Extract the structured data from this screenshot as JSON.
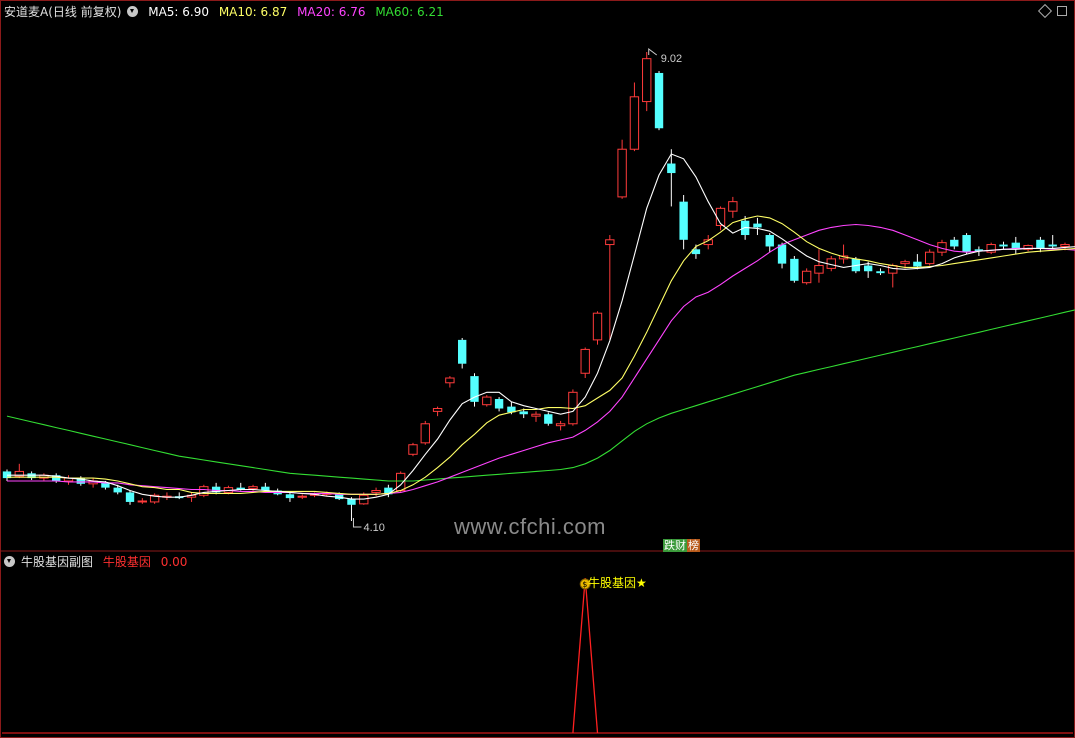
{
  "main_panel": {
    "stock_title": "安道麦A(日线 前复权)",
    "ma_legend": [
      {
        "label": "MA5: 6.90",
        "color": "#ffffff"
      },
      {
        "label": "MA10: 6.87",
        "color": "#ffff66"
      },
      {
        "label": "MA20: 6.76",
        "color": "#ff44ff"
      },
      {
        "label": "MA60: 6.21",
        "color": "#33dd33"
      }
    ],
    "high_label": "9.02",
    "low_label": "4.10",
    "badge_left": "跌财",
    "badge_right": "榜"
  },
  "sub_panel": {
    "title": "牛股基因副图",
    "indicator_name": "牛股基因",
    "indicator_value": "0.00",
    "signal_label": "牛股基因★"
  },
  "watermark": "www.cfchi.com",
  "colors": {
    "up": "#ff3b3b",
    "down": "#54ffff",
    "ma5": "#ffffff",
    "ma10": "#ffff66",
    "ma20": "#ff44ff",
    "ma60": "#33dd33",
    "signal": "#ff2020"
  },
  "chart_data": {
    "type": "candlestick",
    "price_range": [
      4.1,
      9.02
    ],
    "candles": [
      {
        "o": 4.62,
        "h": 4.64,
        "l": 4.52,
        "c": 4.55
      },
      {
        "o": 4.57,
        "h": 4.7,
        "l": 4.55,
        "c": 4.62
      },
      {
        "o": 4.6,
        "h": 4.62,
        "l": 4.53,
        "c": 4.55
      },
      {
        "o": 4.55,
        "h": 4.6,
        "l": 4.52,
        "c": 4.58
      },
      {
        "o": 4.58,
        "h": 4.6,
        "l": 4.5,
        "c": 4.52
      },
      {
        "o": 4.52,
        "h": 4.58,
        "l": 4.48,
        "c": 4.55
      },
      {
        "o": 4.55,
        "h": 4.57,
        "l": 4.47,
        "c": 4.49
      },
      {
        "o": 4.49,
        "h": 4.55,
        "l": 4.45,
        "c": 4.52
      },
      {
        "o": 4.5,
        "h": 4.52,
        "l": 4.43,
        "c": 4.45
      },
      {
        "o": 4.45,
        "h": 4.48,
        "l": 4.38,
        "c": 4.4
      },
      {
        "o": 4.4,
        "h": 4.42,
        "l": 4.27,
        "c": 4.3
      },
      {
        "o": 4.3,
        "h": 4.34,
        "l": 4.28,
        "c": 4.31
      },
      {
        "o": 4.3,
        "h": 4.39,
        "l": 4.28,
        "c": 4.37
      },
      {
        "o": 4.35,
        "h": 4.4,
        "l": 4.32,
        "c": 4.36
      },
      {
        "o": 4.36,
        "h": 4.4,
        "l": 4.33,
        "c": 4.34
      },
      {
        "o": 4.35,
        "h": 4.4,
        "l": 4.3,
        "c": 4.37
      },
      {
        "o": 4.37,
        "h": 4.48,
        "l": 4.35,
        "c": 4.46
      },
      {
        "o": 4.46,
        "h": 4.5,
        "l": 4.38,
        "c": 4.4
      },
      {
        "o": 4.4,
        "h": 4.47,
        "l": 4.38,
        "c": 4.45
      },
      {
        "o": 4.45,
        "h": 4.5,
        "l": 4.42,
        "c": 4.43
      },
      {
        "o": 4.44,
        "h": 4.48,
        "l": 4.4,
        "c": 4.46
      },
      {
        "o": 4.46,
        "h": 4.5,
        "l": 4.41,
        "c": 4.42
      },
      {
        "o": 4.42,
        "h": 4.44,
        "l": 4.37,
        "c": 4.38
      },
      {
        "o": 4.38,
        "h": 4.4,
        "l": 4.3,
        "c": 4.34
      },
      {
        "o": 4.35,
        "h": 4.38,
        "l": 4.33,
        "c": 4.36
      },
      {
        "o": 4.37,
        "h": 4.4,
        "l": 4.35,
        "c": 4.38
      },
      {
        "o": 4.38,
        "h": 4.41,
        "l": 4.36,
        "c": 4.39
      },
      {
        "o": 4.39,
        "h": 4.4,
        "l": 4.32,
        "c": 4.33
      },
      {
        "o": 4.33,
        "h": 4.35,
        "l": 4.1,
        "c": 4.27
      },
      {
        "o": 4.28,
        "h": 4.4,
        "l": 4.27,
        "c": 4.37
      },
      {
        "o": 4.4,
        "h": 4.45,
        "l": 4.36,
        "c": 4.42
      },
      {
        "o": 4.45,
        "h": 4.48,
        "l": 4.35,
        "c": 4.38
      },
      {
        "o": 4.42,
        "h": 4.62,
        "l": 4.4,
        "c": 4.6
      },
      {
        "o": 4.8,
        "h": 4.92,
        "l": 4.78,
        "c": 4.9
      },
      {
        "o": 4.92,
        "h": 5.15,
        "l": 4.9,
        "c": 5.12
      },
      {
        "o": 5.25,
        "h": 5.3,
        "l": 5.2,
        "c": 5.28
      },
      {
        "o": 5.55,
        "h": 5.62,
        "l": 5.5,
        "c": 5.6
      },
      {
        "o": 6.0,
        "h": 6.02,
        "l": 5.7,
        "c": 5.75
      },
      {
        "o": 5.62,
        "h": 5.65,
        "l": 5.3,
        "c": 5.35
      },
      {
        "o": 5.32,
        "h": 5.42,
        "l": 5.3,
        "c": 5.4
      },
      {
        "o": 5.38,
        "h": 5.4,
        "l": 5.25,
        "c": 5.28
      },
      {
        "o": 5.3,
        "h": 5.35,
        "l": 5.22,
        "c": 5.24
      },
      {
        "o": 5.25,
        "h": 5.28,
        "l": 5.18,
        "c": 5.22
      },
      {
        "o": 5.2,
        "h": 5.25,
        "l": 5.14,
        "c": 5.22
      },
      {
        "o": 5.22,
        "h": 5.24,
        "l": 5.1,
        "c": 5.12
      },
      {
        "o": 5.1,
        "h": 5.15,
        "l": 5.05,
        "c": 5.12
      },
      {
        "o": 5.12,
        "h": 5.48,
        "l": 5.1,
        "c": 5.45
      },
      {
        "o": 5.65,
        "h": 5.92,
        "l": 5.6,
        "c": 5.9
      },
      {
        "o": 6.0,
        "h": 6.3,
        "l": 5.95,
        "c": 6.28
      },
      {
        "o": 7.0,
        "h": 7.1,
        "l": 6.0,
        "c": 7.05
      },
      {
        "o": 7.5,
        "h": 8.1,
        "l": 7.48,
        "c": 8.0
      },
      {
        "o": 8.0,
        "h": 8.7,
        "l": 7.98,
        "c": 8.55
      },
      {
        "o": 8.5,
        "h": 9.02,
        "l": 8.4,
        "c": 8.95
      },
      {
        "o": 8.8,
        "h": 8.82,
        "l": 8.2,
        "c": 8.22
      },
      {
        "o": 7.85,
        "h": 8.0,
        "l": 7.4,
        "c": 7.75
      },
      {
        "o": 7.45,
        "h": 7.52,
        "l": 6.95,
        "c": 7.05
      },
      {
        "o": 6.95,
        "h": 7.0,
        "l": 6.85,
        "c": 6.9
      },
      {
        "o": 7.0,
        "h": 7.1,
        "l": 6.95,
        "c": 7.05
      },
      {
        "o": 7.2,
        "h": 7.4,
        "l": 7.15,
        "c": 7.38
      },
      {
        "o": 7.35,
        "h": 7.5,
        "l": 7.28,
        "c": 7.45
      },
      {
        "o": 7.25,
        "h": 7.3,
        "l": 7.05,
        "c": 7.1
      },
      {
        "o": 7.22,
        "h": 7.28,
        "l": 7.1,
        "c": 7.18
      },
      {
        "o": 7.1,
        "h": 7.12,
        "l": 6.92,
        "c": 6.98
      },
      {
        "o": 7.0,
        "h": 7.02,
        "l": 6.75,
        "c": 6.8
      },
      {
        "o": 6.85,
        "h": 6.88,
        "l": 6.6,
        "c": 6.62
      },
      {
        "o": 6.6,
        "h": 6.75,
        "l": 6.58,
        "c": 6.72
      },
      {
        "o": 6.7,
        "h": 6.95,
        "l": 6.6,
        "c": 6.78
      },
      {
        "o": 6.75,
        "h": 6.88,
        "l": 6.72,
        "c": 6.85
      },
      {
        "o": 6.85,
        "h": 7.0,
        "l": 6.8,
        "c": 6.88
      },
      {
        "o": 6.85,
        "h": 6.87,
        "l": 6.7,
        "c": 6.72
      },
      {
        "o": 6.78,
        "h": 6.82,
        "l": 6.65,
        "c": 6.72
      },
      {
        "o": 6.72,
        "h": 6.75,
        "l": 6.68,
        "c": 6.7
      },
      {
        "o": 6.7,
        "h": 6.8,
        "l": 6.55,
        "c": 6.78
      },
      {
        "o": 6.8,
        "h": 6.84,
        "l": 6.75,
        "c": 6.82
      },
      {
        "o": 6.82,
        "h": 6.9,
        "l": 6.74,
        "c": 6.77
      },
      {
        "o": 6.8,
        "h": 6.95,
        "l": 6.78,
        "c": 6.92
      },
      {
        "o": 6.92,
        "h": 7.05,
        "l": 6.88,
        "c": 7.02
      },
      {
        "o": 7.05,
        "h": 7.08,
        "l": 6.95,
        "c": 6.98
      },
      {
        "o": 7.1,
        "h": 7.12,
        "l": 6.9,
        "c": 6.92
      },
      {
        "o": 6.95,
        "h": 6.98,
        "l": 6.88,
        "c": 6.93
      },
      {
        "o": 6.92,
        "h": 7.02,
        "l": 6.9,
        "c": 7.0
      },
      {
        "o": 7.0,
        "h": 7.03,
        "l": 6.95,
        "c": 6.98
      },
      {
        "o": 7.02,
        "h": 7.08,
        "l": 6.9,
        "c": 6.95
      },
      {
        "o": 6.95,
        "h": 7.0,
        "l": 6.93,
        "c": 6.99
      },
      {
        "o": 7.05,
        "h": 7.08,
        "l": 6.92,
        "c": 6.96
      },
      {
        "o": 7.0,
        "h": 7.1,
        "l": 6.95,
        "c": 6.98
      },
      {
        "o": 6.98,
        "h": 7.02,
        "l": 6.94,
        "c": 7.0
      }
    ],
    "ma5": [
      4.58,
      4.58,
      4.58,
      4.58,
      4.57,
      4.55,
      4.54,
      4.52,
      4.51,
      4.47,
      4.42,
      4.38,
      4.36,
      4.35,
      4.35,
      4.37,
      4.4,
      4.41,
      4.42,
      4.43,
      4.43,
      4.42,
      4.41,
      4.4,
      4.39,
      4.38,
      4.36,
      4.35,
      4.33,
      4.33,
      4.35,
      4.38,
      4.48,
      4.63,
      4.8,
      4.96,
      5.16,
      5.33,
      5.4,
      5.45,
      5.45,
      5.35,
      5.31,
      5.28,
      5.25,
      5.22,
      5.25,
      5.4,
      5.65,
      5.99,
      6.41,
      6.89,
      7.38,
      7.73,
      7.95,
      7.9,
      7.71,
      7.45,
      7.22,
      7.12,
      7.18,
      7.17,
      7.14,
      7.06,
      6.97,
      6.88,
      6.82,
      6.79,
      6.76,
      6.78,
      6.8,
      6.78,
      6.75,
      6.74,
      6.75,
      6.76,
      6.8,
      6.86,
      6.9,
      6.93,
      6.94,
      6.95,
      6.95,
      6.96,
      6.96,
      6.96,
      6.97,
      6.98
    ],
    "ma10": [
      4.56,
      4.56,
      4.56,
      4.56,
      4.56,
      4.55,
      4.55,
      4.55,
      4.54,
      4.52,
      4.49,
      4.46,
      4.45,
      4.43,
      4.43,
      4.4,
      4.39,
      4.39,
      4.39,
      4.39,
      4.4,
      4.41,
      4.41,
      4.41,
      4.41,
      4.41,
      4.4,
      4.39,
      4.38,
      4.38,
      4.38,
      4.39,
      4.42,
      4.48,
      4.56,
      4.66,
      4.77,
      4.9,
      5.01,
      5.13,
      5.21,
      5.24,
      5.27,
      5.27,
      5.29,
      5.29,
      5.28,
      5.31,
      5.39,
      5.47,
      5.6,
      5.83,
      6.08,
      6.35,
      6.62,
      6.83,
      6.98,
      7.04,
      7.13,
      7.23,
      7.27,
      7.3,
      7.28,
      7.22,
      7.13,
      7.03,
      6.96,
      6.91,
      6.87,
      6.85,
      6.83,
      6.8,
      6.78,
      6.76,
      6.76,
      6.77,
      6.78,
      6.8,
      6.82,
      6.84,
      6.86,
      6.88,
      6.9,
      6.92,
      6.93,
      6.94,
      6.95,
      6.96
    ],
    "ma20": [
      4.52,
      4.52,
      4.52,
      4.52,
      4.52,
      4.51,
      4.51,
      4.51,
      4.5,
      4.5,
      4.48,
      4.47,
      4.46,
      4.45,
      4.44,
      4.43,
      4.43,
      4.42,
      4.42,
      4.41,
      4.41,
      4.4,
      4.4,
      4.4,
      4.39,
      4.39,
      4.39,
      4.38,
      4.38,
      4.38,
      4.38,
      4.39,
      4.4,
      4.43,
      4.47,
      4.51,
      4.56,
      4.61,
      4.66,
      4.71,
      4.76,
      4.8,
      4.84,
      4.88,
      4.92,
      4.95,
      4.98,
      5.05,
      5.14,
      5.25,
      5.4,
      5.6,
      5.8,
      6.0,
      6.2,
      6.35,
      6.45,
      6.5,
      6.58,
      6.67,
      6.75,
      6.83,
      6.92,
      7.0,
      7.05,
      7.1,
      7.15,
      7.18,
      7.2,
      7.21,
      7.2,
      7.18,
      7.15,
      7.1,
      7.05,
      7.0,
      6.96,
      6.93,
      6.92,
      6.93,
      6.94,
      6.95,
      6.96,
      6.96,
      6.96,
      6.95,
      6.95,
      6.94
    ],
    "ma60": [
      5.2,
      5.17,
      5.14,
      5.11,
      5.08,
      5.05,
      5.02,
      4.99,
      4.96,
      4.93,
      4.9,
      4.87,
      4.84,
      4.81,
      4.78,
      4.76,
      4.74,
      4.72,
      4.7,
      4.68,
      4.66,
      4.64,
      4.62,
      4.6,
      4.59,
      4.58,
      4.57,
      4.56,
      4.55,
      4.54,
      4.53,
      4.52,
      4.52,
      4.52,
      4.53,
      4.54,
      4.55,
      4.56,
      4.57,
      4.58,
      4.59,
      4.6,
      4.61,
      4.62,
      4.63,
      4.64,
      4.66,
      4.7,
      4.76,
      4.84,
      4.94,
      5.04,
      5.12,
      5.18,
      5.23,
      5.27,
      5.31,
      5.35,
      5.39,
      5.43,
      5.47,
      5.51,
      5.55,
      5.59,
      5.63,
      5.66,
      5.69,
      5.72,
      5.75,
      5.78,
      5.81,
      5.84,
      5.87,
      5.9,
      5.93,
      5.96,
      5.99,
      6.02,
      6.05,
      6.08,
      6.11,
      6.14,
      6.17,
      6.2,
      6.23,
      6.26,
      6.29,
      6.32
    ],
    "signal_index": 47,
    "signal_range": [
      0,
      1
    ]
  }
}
